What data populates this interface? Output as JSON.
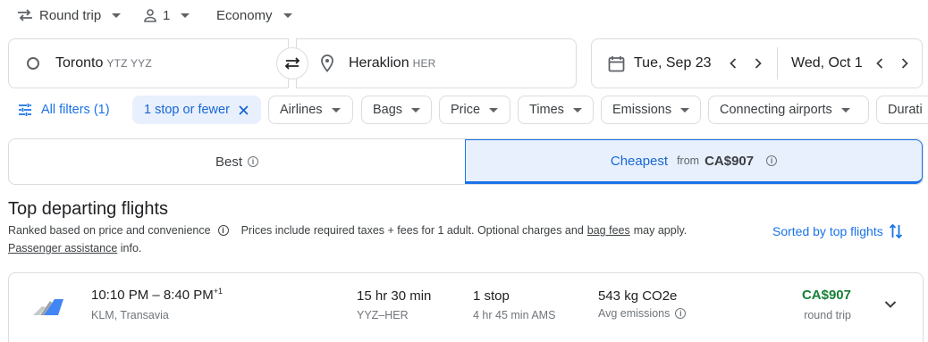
{
  "top_bar": {
    "trip_type": "Round trip",
    "passengers": "1",
    "cabin_class": "Economy"
  },
  "search": {
    "origin_city": "Toronto",
    "origin_codes": "YTZ YYZ",
    "destination_city": "Heraklion",
    "destination_code": "HER",
    "depart_date": "Tue, Sep 23",
    "return_date": "Wed, Oct 1"
  },
  "filters": {
    "all_filters": "All filters (1)",
    "active_stops": "1 stop or fewer",
    "chips": [
      "Airlines",
      "Bags",
      "Price",
      "Times",
      "Emissions",
      "Connecting airports",
      "Durati"
    ]
  },
  "tabs": {
    "best": "Best",
    "cheapest": "Cheapest",
    "cheapest_from": "from",
    "cheapest_price": "CA$907"
  },
  "results": {
    "heading": "Top departing flights",
    "ranked_text": "Ranked based on price and convenience",
    "prices_text": "Prices include required taxes + fees for 1 adult. Optional charges and",
    "bag_fees": "bag fees",
    "may_apply": "may apply.",
    "passenger_assistance": "Passenger assistance",
    "info_suffix": "info.",
    "sorted_by": "Sorted by top flights"
  },
  "flight": {
    "times": "10:10 PM – 8:40 PM",
    "day_offset": "+1",
    "airlines": "KLM, Transavia",
    "duration": "15 hr 30 min",
    "route": "YYZ–HER",
    "stops": "1 stop",
    "layover": "4 hr 45 min AMS",
    "emissions": "543 kg CO2e",
    "emissions_label": "Avg emissions",
    "price": "CA$907",
    "price_note": "round trip"
  },
  "colors": {
    "accent_blue": "#1a73e8",
    "price_green": "#188038",
    "chip_active_bg": "#e8f0fe"
  }
}
